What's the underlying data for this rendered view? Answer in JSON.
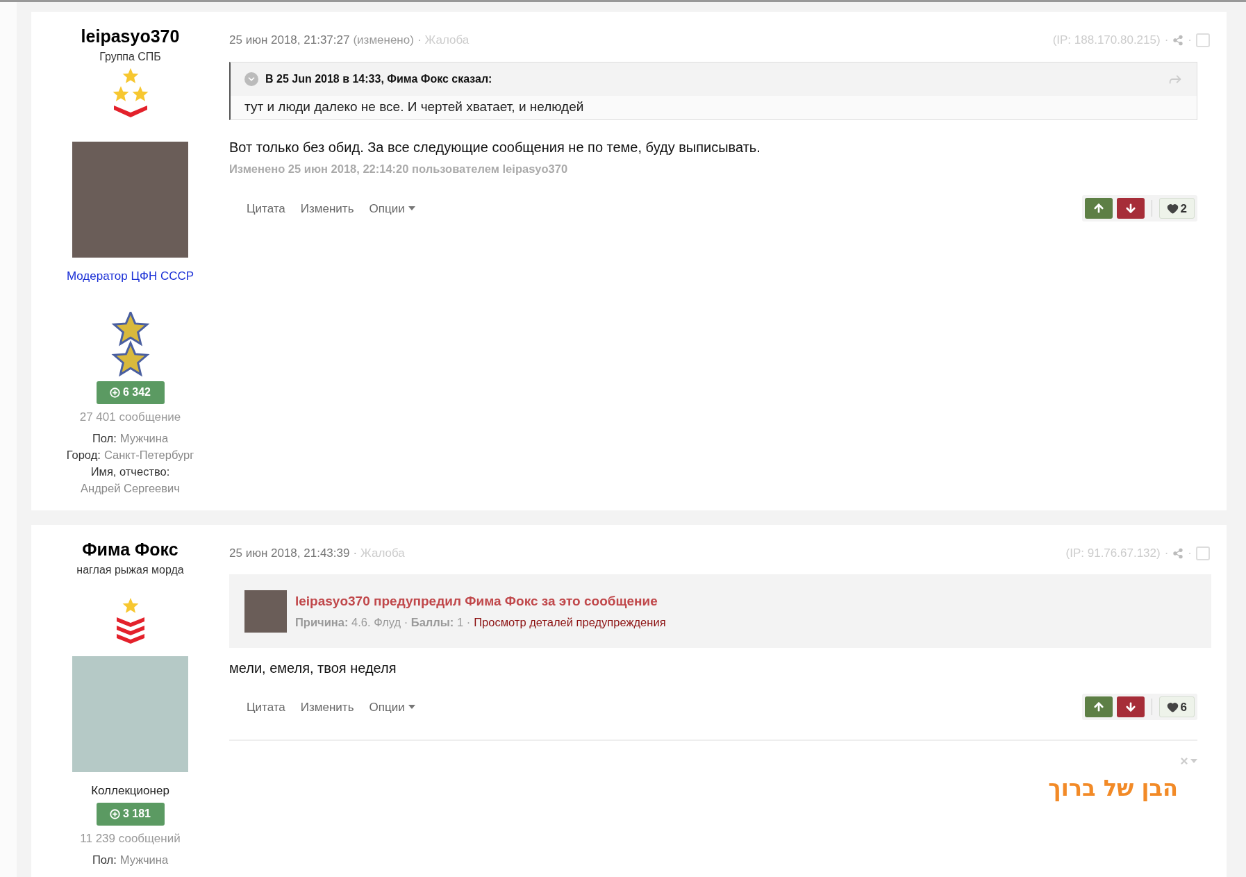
{
  "posts": [
    {
      "author": {
        "name": "leipasyo370",
        "group": "Группа СПБ",
        "rank": {
          "kind": "three-stars"
        },
        "title": {
          "text": "Модератор ЦФН СССР",
          "kind": "link"
        },
        "medal": {
          "kind": "double-star"
        },
        "reputation": "6 342",
        "posts_count": "27 401 сообщение",
        "fields": [
          {
            "label": "Пол:",
            "value": "Мужчина"
          },
          {
            "label": "Город:",
            "value": "Санкт-Петербург"
          },
          {
            "label": "Имя, отчество:",
            "value": "Андрей Сергеевич"
          }
        ]
      },
      "meta": {
        "date": "25 июн 2018, 21:37:27",
        "edited": "(изменено)",
        "sep": "·",
        "report": "Жалоба",
        "ip": "(IP: 188.170.80.215)",
        "checked": false
      },
      "quote": {
        "header": "В 25 Jun 2018 в 14:33, Фима Фокс сказал:",
        "text": "тут и люди далеко не все. И чертей хватает, и нелюдей"
      },
      "body": "Вот только без обид. За все следующие сообщения не по теме, буду выписывать.",
      "edited_by": "Изменено 25 июн 2018, 22:14:20 пользователем leipasyo370",
      "actions": [
        "Цитата",
        "Изменить",
        "Опции"
      ],
      "likes": "2"
    },
    {
      "author": {
        "name": "Фима Фокс",
        "group": "наглая рыжая морда",
        "rank": {
          "kind": "star-chevrons"
        },
        "title": {
          "text": "Коллекционер",
          "kind": "plain"
        },
        "reputation": "3 181",
        "posts_count": "11 239 сообщений",
        "fields": [
          {
            "label": "Пол:",
            "value": "Мужчина"
          }
        ]
      },
      "meta": {
        "date": "25 июн 2018, 21:43:39",
        "sep": "·",
        "report": "Жалоба",
        "ip": "(IP: 91.76.67.132)",
        "checked": false
      },
      "warning": {
        "title": "leipasyo370 предупредил Фима Фокс за это сообщение",
        "details": "**Причина:** 4.6. Флуд · **Баллы:** 1 ·",
        "link": "Просмотр деталей предупреждения"
      },
      "body": "мели, емеля, твоя неделя",
      "actions": [
        "Цитата",
        "Изменить",
        "Опции"
      ],
      "likes": "6",
      "signature": "הבן של ברוך"
    }
  ]
}
